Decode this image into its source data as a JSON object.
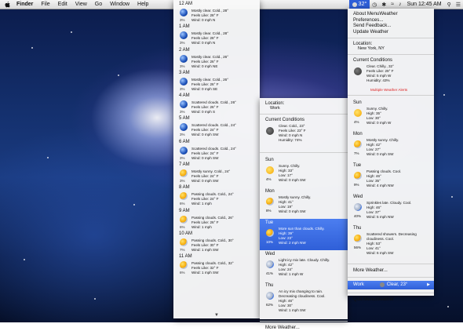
{
  "menubar": {
    "app": "Finder",
    "menus": [
      "File",
      "Edit",
      "View",
      "Go",
      "Window",
      "Help"
    ],
    "weather_temp": "32°",
    "clock": "Sun 12:45 AM"
  },
  "hourly": [
    {
      "time": "12 AM",
      "icon": "moon-globe-icon",
      "pct": "3%",
      "lines": [
        "Mostly clear. Cold., 28°",
        "Feels Like: 28° F",
        "Wind: 0 mph N"
      ]
    },
    {
      "time": "1 AM",
      "icon": "moon-globe-icon",
      "pct": "3%",
      "lines": [
        "Mostly clear. Cold., 28°",
        "Feels Like: 28° F",
        "Wind: 0 mph N"
      ]
    },
    {
      "time": "2 AM",
      "icon": "moon-globe-icon",
      "pct": "3%",
      "lines": [
        "Mostly clear. Cold., 26°",
        "Feels Like: 26° F",
        "Wind: 0 mph NE"
      ]
    },
    {
      "time": "3 AM",
      "icon": "moon-globe-icon",
      "pct": "3%",
      "lines": [
        "Mostly clear. Cold., 26°",
        "Feels Like: 26° F",
        "Wind: 0 mph SE"
      ]
    },
    {
      "time": "4 AM",
      "icon": "cloudy-night-icon",
      "pct": "3%",
      "lines": [
        "Scattered clouds. Cold., 26°",
        "Feels Like: 26° F",
        "Wind: 0 mph S"
      ]
    },
    {
      "time": "5 AM",
      "icon": "cloudy-night-icon",
      "pct": "3%",
      "lines": [
        "Scattered clouds. Cold., 24°",
        "Feels Like: 24° F",
        "Wind: 0 mph SW"
      ]
    },
    {
      "time": "6 AM",
      "icon": "cloudy-night-icon",
      "pct": "3%",
      "lines": [
        "Scattered clouds. Cold., 24°",
        "Feels Like: 24° F",
        "Wind: 0 mph SW"
      ]
    },
    {
      "time": "7 AM",
      "icon": "partly-sunny-icon",
      "pct": "3%",
      "lines": [
        "Mostly sunny. Cold., 24°",
        "Feels Like: 24° F",
        "Wind: 0 mph SW"
      ]
    },
    {
      "time": "8 AM",
      "icon": "partly-sunny-icon",
      "pct": "6%",
      "lines": [
        "Passing clouds. Cold., 24°",
        "Feels Like: 24° F",
        "Wind: 1 mph"
      ]
    },
    {
      "time": "9 AM",
      "icon": "partly-sunny-icon",
      "pct": "6%",
      "lines": [
        "Passing clouds. Cold., 26°",
        "Feels Like: 26° F",
        "Wind: 1 mph"
      ]
    },
    {
      "time": "10 AM",
      "icon": "partly-sunny-icon",
      "pct": "7%",
      "lines": [
        "Passing clouds. Cold., 30°",
        "Feels Like: 30° F",
        "Wind: 1 mph SW"
      ]
    },
    {
      "time": "11 AM",
      "icon": "partly-sunny-icon",
      "pct": "6%",
      "lines": [
        "Passing clouds. Cold., 32°",
        "Feels Like: 32° F",
        "Wind: 1 mph SW"
      ]
    }
  ],
  "work": {
    "location_label": "Location:",
    "location": "Work",
    "current_label": "Current Conditions",
    "current": [
      "Clear. Cold., 23°",
      "Feels Like: 23° F",
      "Wind: 0 mph N",
      "Humidity: 74%"
    ],
    "days": [
      {
        "label": "Sun",
        "icon": "sun-icon",
        "pct": "4%",
        "lines": [
          "Sunny. Chilly.",
          "High: 33°",
          "Low: 17°",
          "Wind: 0 mph SW"
        ]
      },
      {
        "label": "Mon",
        "icon": "partly-sunny-icon",
        "pct": "8%",
        "lines": [
          "Mostly sunny. Chilly.",
          "High: 41°",
          "Low: 19°",
          "Wind: 0 mph SW"
        ]
      },
      {
        "label": "Tue",
        "icon": "partly-sunny-icon",
        "pct": "10%",
        "lines": [
          "More sun than clouds. Chilly.",
          "High: 39°",
          "Low: 23°",
          "Wind: 2 mph NW"
        ]
      },
      {
        "label": "Wed",
        "icon": "rain-icon",
        "pct": "41%",
        "lines": [
          "Light icy mix late. Cloudy. Chilly.",
          "High: 42°",
          "Low: 24°",
          "Wind: 1 mph W"
        ]
      },
      {
        "label": "Thu",
        "icon": "rain-icon",
        "pct": "62%",
        "lines": [
          "An icy mix changing to rain.",
          "Decreasing cloudiness. Cool.",
          "High: 46°",
          "Low: 30°",
          "Wind: 1 mph SW"
        ]
      }
    ],
    "more": "More Weather..."
  },
  "main_menu": {
    "items": [
      "About MenuWeather",
      "Preferences...",
      "Send Feedback...",
      "Update Weather"
    ],
    "location_label": "Location:",
    "location": "New York, NY",
    "current_label": "Current Conditions",
    "current": [
      "Clear. Chilly., 32°",
      "Feels Like: 29° F",
      "Wind: 5 mph W",
      "Humidity: 43%"
    ],
    "alert": "Multiple Weather Alerts",
    "days": [
      {
        "label": "Sun",
        "icon": "sun-icon",
        "pct": "4%",
        "lines": [
          "Sunny. Chilly.",
          "High: 35°",
          "Low: 30°",
          "Wind: 0 mph W"
        ]
      },
      {
        "label": "Mon",
        "icon": "partly-sunny-icon",
        "pct": "7%",
        "lines": [
          "Mostly sunny. Chilly.",
          "High: 42°",
          "Low: 27°",
          "Wind: 0 mph SW"
        ]
      },
      {
        "label": "Tue",
        "icon": "partly-sunny-icon",
        "pct": "9%",
        "lines": [
          "Passing clouds. Cool.",
          "High: 46°",
          "Low: 35°",
          "Wind: 4 mph NW"
        ]
      },
      {
        "label": "Wed",
        "icon": "rain-icon",
        "pct": "40%",
        "lines": [
          "Sprinkles late. Cloudy. Cool.",
          "High: 46°",
          "Low: 37°",
          "Wind: 5 mph NW"
        ]
      },
      {
        "label": "Thu",
        "icon": "partly-sunny-icon",
        "pct": "56%",
        "lines": [
          "Scattered showers. Decreasing",
          "cloudiness. Cool.",
          "High: 53°",
          "Low: 41°",
          "Wind: 6 mph SW"
        ]
      }
    ],
    "more": "More Weather...",
    "work_label": "Work",
    "work_value": "Clear, 23°",
    "quit": "Quit MenuWeather"
  }
}
